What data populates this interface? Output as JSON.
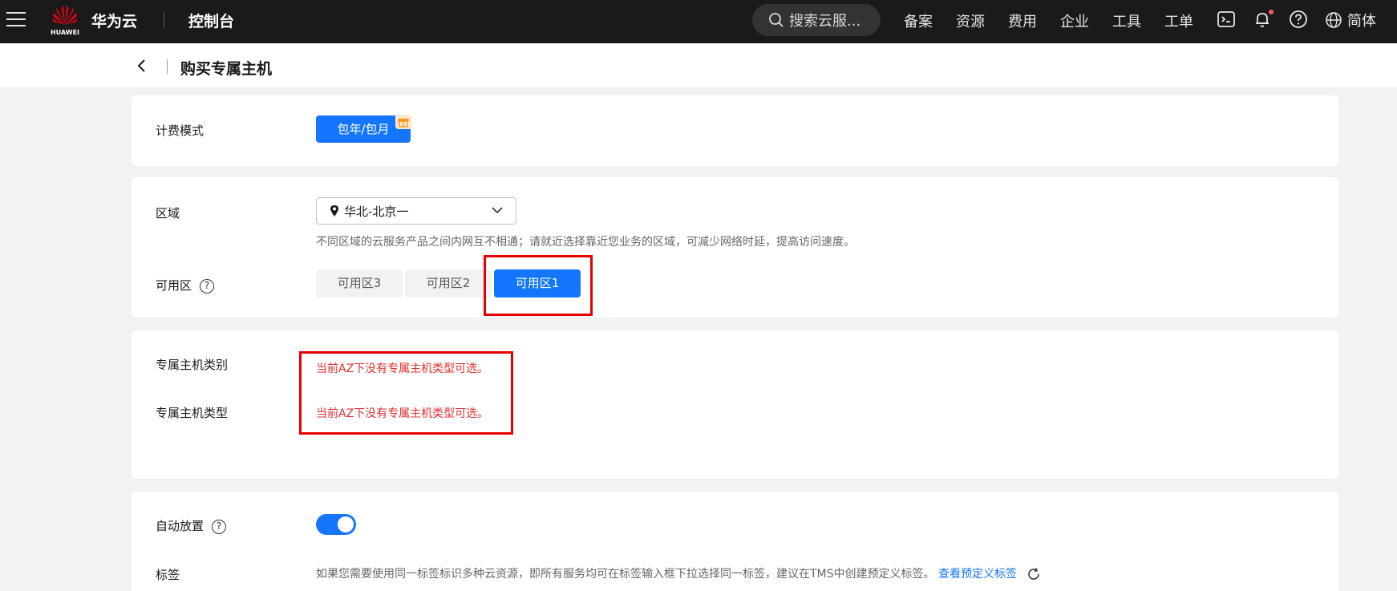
{
  "topbar": {
    "logo_text": "HUAWEI",
    "brand": "华为云",
    "console": "控制台",
    "search_placeholder": "搜索云服...",
    "nav": [
      "备案",
      "资源",
      "费用",
      "企业",
      "工具",
      "工单"
    ],
    "language": "简体",
    "icons": [
      "menu-icon",
      "terminal-icon",
      "bell-icon",
      "help-icon",
      "globe-icon"
    ],
    "notification_dot_color": "#ff5a5a"
  },
  "header": {
    "title": "购买专属主机"
  },
  "billing": {
    "label": "计费模式",
    "selected": "包年/包月",
    "badge_icon": "gift-icon"
  },
  "region": {
    "label": "区域",
    "selected": "华北-北京一",
    "hint": "不同区域的云服务产品之间内网互不相通；请就近选择靠近您业务的区域，可减少网络时延，提高访问速度。",
    "az_label": "可用区",
    "az_options": [
      "可用区3",
      "可用区2",
      "可用区1"
    ],
    "az_selected": "可用区1"
  },
  "host": {
    "category_label": "专属主机类别",
    "type_label": "专属主机类型",
    "category_message": "当前AZ下没有专属主机类型可选。",
    "type_message": "当前AZ下没有专属主机类型可选。"
  },
  "placement": {
    "auto_label": "自动放置",
    "auto_enabled": true,
    "tag_label": "标签",
    "tag_hint": "如果您需要使用同一标签标识多种云资源，即所有服务均可在标签输入框下拉选择同一标签，建议在TMS中创建预定义标签。",
    "tag_link": "查看预定义标签"
  },
  "colors": {
    "primary": "#1476ff",
    "error": "#e52e2e",
    "highlight_box": "#e60000",
    "topbar_bg": "#1a1a1a"
  }
}
